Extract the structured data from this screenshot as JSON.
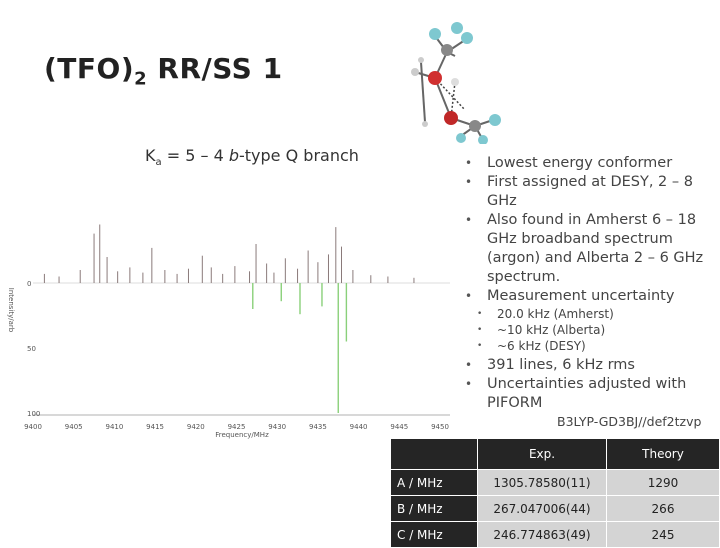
{
  "title": {
    "main": "(TFO)",
    "sub": "2",
    "rest": " RR/SS 1"
  },
  "subtitle": {
    "k": "K",
    "k_sub": "a",
    "text1": " = 5 – 4 ",
    "italic": "b",
    "text2": "-type Q branch"
  },
  "bullets": [
    "Lowest energy conformer",
    "First assigned at DESY, 2 – 8 GHz",
    "Also found in Amherst 6 – 18 GHz broadband spectrum (argon) and Alberta 2 – 6 GHz spectrum.",
    "Measurement uncertainty"
  ],
  "sub_bullets": [
    "20.0 kHz (Amherst)",
    "~10 kHz (Alberta)",
    "~6 kHz (DESY)"
  ],
  "bullets2": [
    "391 lines, 6 kHz rms",
    "Uncertainties adjusted with PIFORM"
  ],
  "method": "B3LYP-GD3BJ//def2tzvp",
  "table": {
    "headers": [
      "",
      "Exp.",
      "Theory"
    ],
    "rows": [
      {
        "label": "A / MHz",
        "exp": "1305.78580(11)",
        "theory": "1290"
      },
      {
        "label": "B / MHz",
        "exp": "267.047006(44)",
        "theory": "266"
      },
      {
        "label": "C / MHz",
        "exp": "246.774863(49)",
        "theory": "245"
      }
    ]
  },
  "spectrum": {
    "x_ticks": [
      "9400",
      "9405",
      "9410",
      "9415",
      "9420",
      "9425",
      "9430",
      "9435",
      "9440",
      "9445",
      "9450"
    ],
    "y_ticks": [
      "0",
      "50",
      "100"
    ],
    "xlabel": "Frequency/MHz",
    "ylabel": "Intensity/arb",
    "xlim": [
      9400,
      9450
    ],
    "ylim": [
      -50,
      110
    ],
    "observed": [
      {
        "x": 9401.4,
        "y": -7
      },
      {
        "x": 9403.2,
        "y": -5
      },
      {
        "x": 9405.8,
        "y": -10
      },
      {
        "x": 9407.5,
        "y": -38
      },
      {
        "x": 9408.2,
        "y": -45
      },
      {
        "x": 9409.1,
        "y": -20
      },
      {
        "x": 9410.4,
        "y": -9
      },
      {
        "x": 9411.9,
        "y": -12
      },
      {
        "x": 9413.5,
        "y": -8
      },
      {
        "x": 9414.6,
        "y": -27
      },
      {
        "x": 9416.2,
        "y": -10
      },
      {
        "x": 9417.7,
        "y": -7
      },
      {
        "x": 9419.1,
        "y": -11
      },
      {
        "x": 9420.8,
        "y": -21
      },
      {
        "x": 9421.9,
        "y": -12
      },
      {
        "x": 9423.3,
        "y": -7
      },
      {
        "x": 9424.8,
        "y": -13
      },
      {
        "x": 9426.6,
        "y": -9
      },
      {
        "x": 9427.4,
        "y": -30
      },
      {
        "x": 9428.7,
        "y": -15
      },
      {
        "x": 9429.6,
        "y": -8
      },
      {
        "x": 9431.0,
        "y": -19
      },
      {
        "x": 9432.5,
        "y": -11
      },
      {
        "x": 9433.8,
        "y": -25
      },
      {
        "x": 9435.0,
        "y": -16
      },
      {
        "x": 9436.3,
        "y": -22
      },
      {
        "x": 9437.2,
        "y": -43
      },
      {
        "x": 9437.9,
        "y": -28
      },
      {
        "x": 9439.3,
        "y": -10
      },
      {
        "x": 9441.5,
        "y": -6
      },
      {
        "x": 9443.6,
        "y": -5
      },
      {
        "x": 9446.8,
        "y": -4
      }
    ],
    "predicted": [
      {
        "x": 9427.0,
        "y": 20
      },
      {
        "x": 9430.5,
        "y": 14
      },
      {
        "x": 9432.8,
        "y": 24
      },
      {
        "x": 9435.5,
        "y": 18
      },
      {
        "x": 9437.5,
        "y": 100
      },
      {
        "x": 9438.5,
        "y": 45
      }
    ],
    "colors": {
      "observed": "#8a7a7a",
      "predicted": "#8ad07a"
    }
  }
}
